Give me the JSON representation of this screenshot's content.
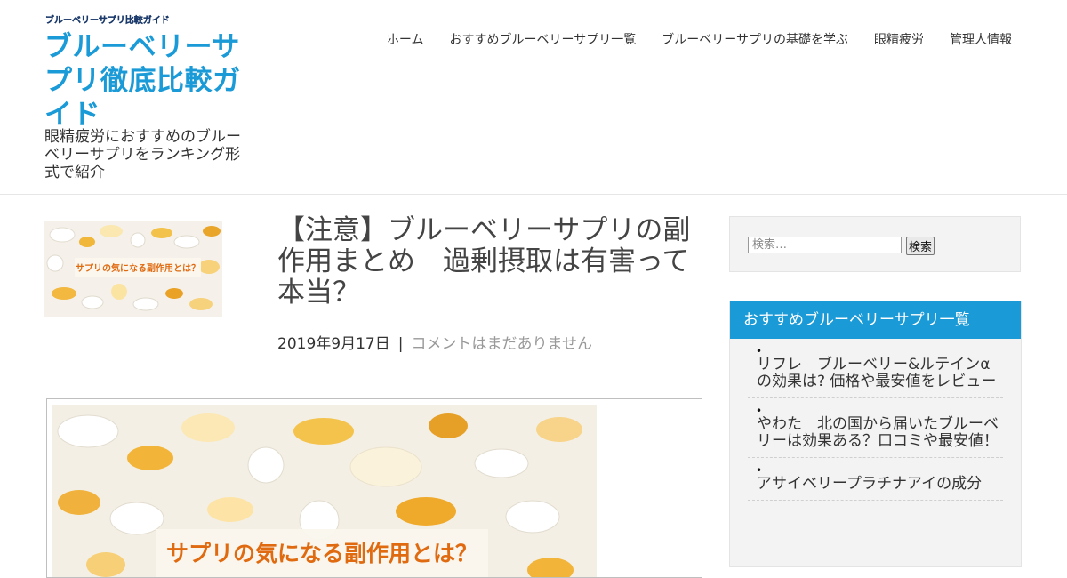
{
  "header": {
    "logo_small_text": "ブルーベリーサプリ比較ガイド",
    "site_title": "ブルーベリーサプリ徹底比較ガイド",
    "site_description": "眼精疲労におすすめのブルーベリーサプリをランキング形式で紹介"
  },
  "nav": {
    "items": [
      {
        "label": "ホーム"
      },
      {
        "label": "おすすめブルーベリーサプリ一覧"
      },
      {
        "label": "ブルーベリーサプリの基礎を学ぶ"
      },
      {
        "label": "眼精疲労"
      },
      {
        "label": "管理人情報"
      }
    ]
  },
  "post": {
    "title": "【注意】ブルーベリーサプリの副作用まとめ　過剰摂取は有害って本当？",
    "date": "2019年9月17日",
    "separator": "|",
    "comments": "コメントはまだありません",
    "thumbnail_caption": "サプリの気になる副作用とは？",
    "featured_caption": "サプリの気になる副作用とは？"
  },
  "sidebar": {
    "search": {
      "placeholder": "検索…",
      "button_label": "検索"
    },
    "widget": {
      "title": "おすすめブルーベリーサプリ一覧",
      "bullet": "•",
      "items": [
        {
          "label": "リフレ　ブルーベリー&ルテインαの効果は? 価格や最安値をレビュー"
        },
        {
          "label": "やわた　北の国から届いたブルーベリーは効果ある？口コミや最安値！"
        },
        {
          "label": "アサイベリープラチナアイの成分"
        }
      ]
    }
  },
  "colors": {
    "accent": "#1a9ad6",
    "caption_orange": "#e06a10"
  }
}
